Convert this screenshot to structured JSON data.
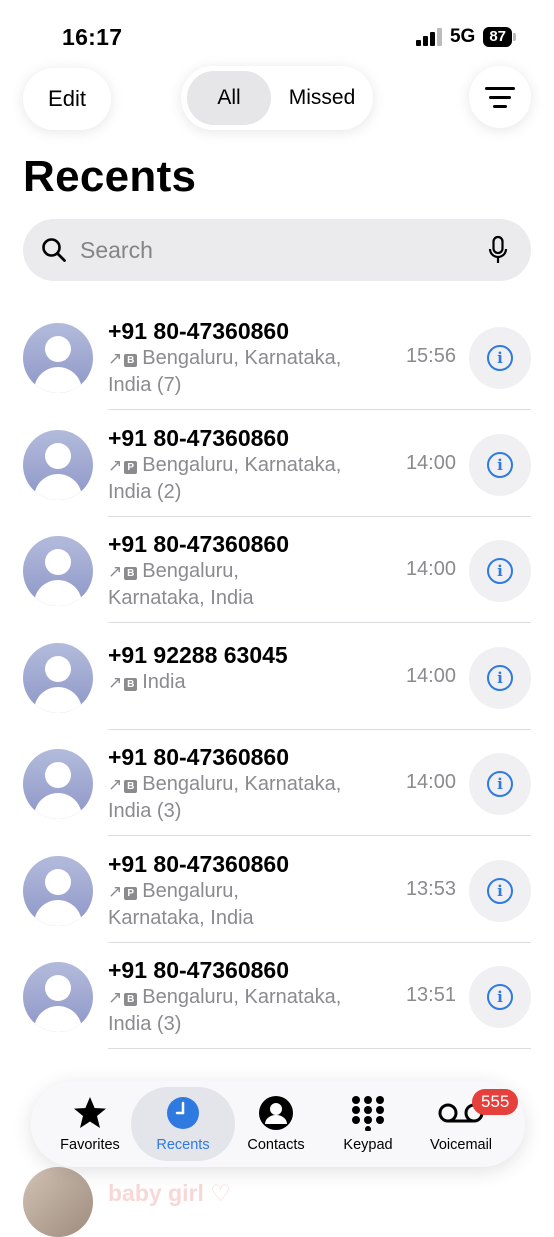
{
  "status_bar": {
    "time": "16:17",
    "network": "5G",
    "battery": "87"
  },
  "toolbar": {
    "edit_label": "Edit",
    "filter_all": "All",
    "filter_missed": "Missed"
  },
  "page": {
    "title": "Recents"
  },
  "search": {
    "placeholder": "Search"
  },
  "calls": [
    {
      "number": "+91 80-47360860",
      "badge": "B",
      "location_line1": "Bengaluru, Karnataka,",
      "location_line2": "India (7)",
      "time": "15:56"
    },
    {
      "number": "+91 80-47360860",
      "badge": "P",
      "location_line1": "Bengaluru, Karnataka,",
      "location_line2": "India (2)",
      "time": "14:00"
    },
    {
      "number": "+91 80-47360860",
      "badge": "B",
      "location_line1": "Bengaluru,",
      "location_line2": "Karnataka, India",
      "time": "14:00"
    },
    {
      "number": "+91 92288 63045",
      "badge": "B",
      "location_line1": "India",
      "location_line2": "",
      "time": "14:00"
    },
    {
      "number": "+91 80-47360860",
      "badge": "B",
      "location_line1": "Bengaluru, Karnataka,",
      "location_line2": "India (3)",
      "time": "14:00"
    },
    {
      "number": "+91 80-47360860",
      "badge": "P",
      "location_line1": "Bengaluru,",
      "location_line2": "Karnataka, India",
      "time": "13:53"
    },
    {
      "number": "+91 80-47360860",
      "badge": "B",
      "location_line1": "Bengaluru, Karnataka,",
      "location_line2": "India (3)",
      "time": "13:51"
    }
  ],
  "partial_rows": [
    {
      "name": "baby girl ♡"
    }
  ],
  "tab_bar": {
    "tabs": [
      "Favorites",
      "Recents",
      "Contacts",
      "Keypad",
      "Voicemail"
    ],
    "active": "Recents",
    "voicemail_badge": "555"
  },
  "colors": {
    "accent": "#2e7ae0",
    "badge": "#e6403c",
    "avatar": "#9aa3cf"
  }
}
